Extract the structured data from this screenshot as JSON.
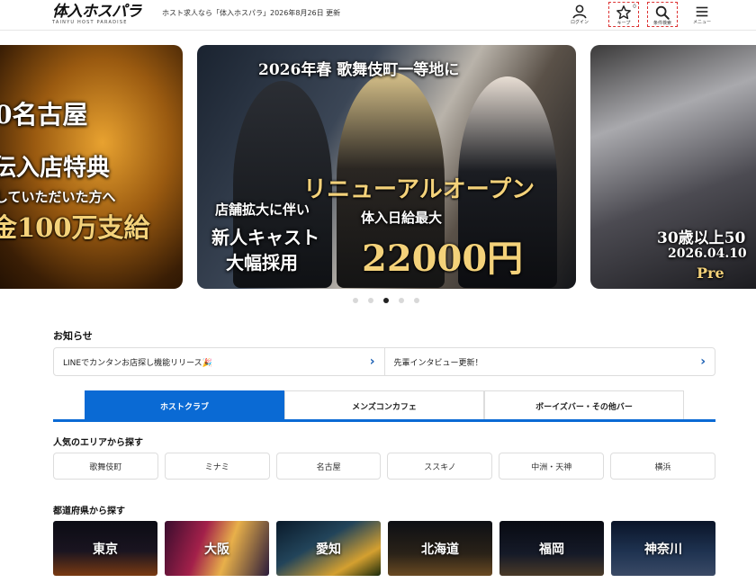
{
  "header": {
    "logo_text": "体入ホスパラ",
    "logo_sub": "TAINYU HOST PARADISE",
    "tagline": "ホスト求人なら「体入ホスパラ」",
    "updated": "2026年8月26日 更新",
    "buttons": [
      {
        "label": "ログイン",
        "icon": "user-icon"
      },
      {
        "label": "キープ",
        "icon": "star-icon",
        "badge": "0"
      },
      {
        "label": "条件検索",
        "icon": "search-icon"
      },
      {
        "label": "メニュー",
        "icon": "menu-icon"
      }
    ]
  },
  "carousel": {
    "left": {
      "line1": "0名古屋",
      "line2": "伝入店特典",
      "line3": "していただいた方へ",
      "line4": "金100万支給"
    },
    "center": {
      "headline": "2026年春 歌舞伎町一等地に",
      "renewal": "リニューアルオープン",
      "pay_label": "体入日給最大",
      "pay_amount": "22000円",
      "sub1": "店舗拡大に伴い",
      "sub2": "新人キャスト",
      "sub3": "大幅採用"
    },
    "right": {
      "line1": "30歳以上50",
      "line2": "2026.04.10",
      "line3": "Pre"
    },
    "dots": 5,
    "active_dot": 2
  },
  "news": {
    "title": "お知らせ",
    "items": [
      "LINEでカンタンお店探し機能リリース🎉",
      "先輩インタビュー更新！"
    ]
  },
  "tabs": [
    {
      "label": "ホストクラブ",
      "active": true
    },
    {
      "label": "メンズコンカフェ",
      "active": false
    },
    {
      "label": "ボーイズバー・その他バー",
      "active": false
    }
  ],
  "areas": {
    "title": "人気のエリアから探す",
    "items": [
      "歌舞伎町",
      "ミナミ",
      "名古屋",
      "ススキノ",
      "中洲・天神",
      "横浜"
    ]
  },
  "prefectures": {
    "title": "都道府県から探す",
    "items": [
      "東京",
      "大阪",
      "愛知",
      "北海道",
      "福岡",
      "神奈川"
    ]
  },
  "colors": {
    "accent": "#0a6ad4",
    "chevron": "#1a5fb4"
  }
}
